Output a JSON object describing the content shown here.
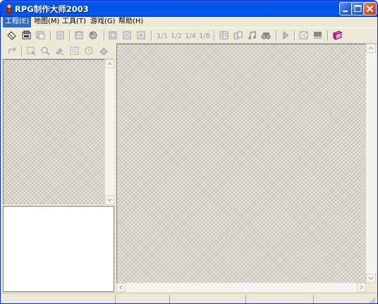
{
  "window": {
    "title": "RPG制作大师2003",
    "controls": [
      "minimize-icon",
      "maximize-icon",
      "close-icon"
    ]
  },
  "menu": {
    "items": [
      {
        "label": "工程(E)",
        "active": true
      },
      {
        "label": "地图(M)",
        "active": false
      },
      {
        "label": "工具(T)",
        "active": false
      },
      {
        "label": "游戏(G)",
        "active": false
      },
      {
        "label": "帮助(H)",
        "active": false
      }
    ]
  },
  "toolbar": {
    "main_icons": [
      "new-project-icon",
      "open-project-icon",
      "close-project-icon",
      "create-backup-icon",
      "save-icon",
      "undo-icon",
      "layer-lower-icon",
      "layer-upper-icon",
      "event-layer-icon",
      "zoom-1-1-icon",
      "zoom-1-2-icon",
      "zoom-1-4-icon",
      "zoom-1-8-icon",
      "database-icon",
      "material-icon",
      "music-icon",
      "search-icon",
      "play-test-icon",
      "fullscreen-icon",
      "title-screen-icon",
      "help-book-icon"
    ],
    "left_icons": [
      "undo-icon",
      "pencil-icon",
      "rectangle-icon",
      "ellipse-icon",
      "fill-icon",
      "select-icon",
      "zoom-icon"
    ]
  },
  "colors": {
    "titlebar": "#0054e3",
    "menu_highlight": "#316ac5",
    "window_bg": "#ece9d8",
    "hatch_bg": "#c9c6b8"
  }
}
